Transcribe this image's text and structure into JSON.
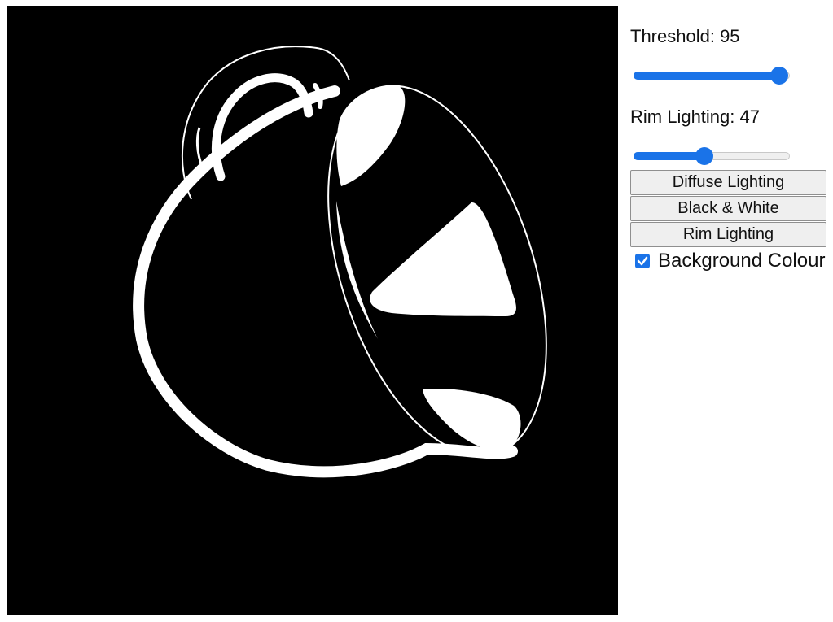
{
  "controls": {
    "threshold": {
      "label": "Threshold: ",
      "value": "95",
      "fraction": 0.95
    },
    "rim_lighting": {
      "label": "Rim Lighting: ",
      "value": "47",
      "fraction": 0.47
    }
  },
  "buttons": {
    "diffuse": "Diffuse Lighting",
    "black_white": "Black & White",
    "rim": "Rim Lighting"
  },
  "background_colour": {
    "label": "Background Colour",
    "checked": true
  },
  "colors": {
    "accent": "#1a73e8",
    "canvas_bg": "#000000",
    "highlight": "#ffffff"
  }
}
